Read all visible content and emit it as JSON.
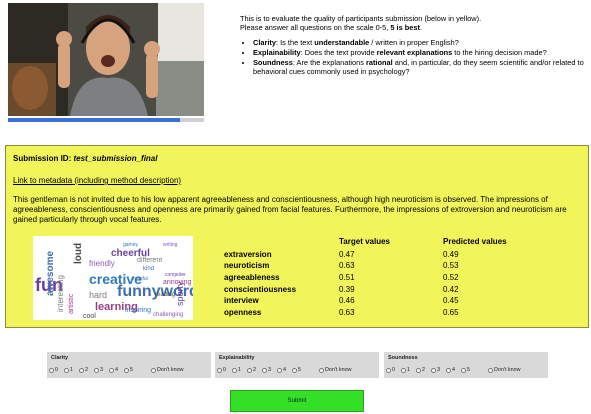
{
  "video": {
    "progress": 0.88
  },
  "instructions": {
    "intro_line1": "This is to evaluate the quality of participants submission (below in yellow).",
    "intro_line2_prefix": "Please answer all questions on the scale 0-5, ",
    "intro_line2_bold": "5 is best",
    "intro_line2_suffix": ".",
    "criteria": [
      {
        "name": "Clarity",
        "pre": ": Is the text ",
        "bold": "understandable",
        "post": " / written in proper English?"
      },
      {
        "name": "Explainability",
        "pre": ": Does the text provide ",
        "bold": "relevant explanations",
        "post": " to the hiring decision made?"
      },
      {
        "name": "Soundness",
        "pre": ": Are the explanations ",
        "bold": "rational",
        "post": " and, in particular, do they seem scientific and/or related to behavioral cues commonly used in psychology?"
      }
    ]
  },
  "submission": {
    "id_label": "Submission ID: ",
    "id_value": "test_submission_final",
    "metadata_link": "Link to metadata (including method description)",
    "explanation": "This gentleman is not invited due to his low apparent agreeableness and conscientiousness, although high neuroticism is observed. The impressions of agreeableness, conscientiousness and openness are primarily gained from facial features. Furthermore, the impressions of extroversion and neuroticism are gained particularly through vocal features.",
    "word_cloud": [
      "fun",
      "awesome",
      "interesting",
      "artistic",
      "loud",
      "creative",
      "friendly",
      "cheerful",
      "funnyword",
      "hard",
      "learning",
      "cool",
      "inspiring",
      "challenging",
      "sporty",
      "kind",
      "different",
      "annoying",
      "reading",
      "gamey",
      "writing",
      "computer",
      "helpful"
    ],
    "table": {
      "col_target": "Target values",
      "col_predicted": "Predicted values",
      "rows": [
        {
          "trait": "extraversion",
          "target": "0.47",
          "predicted": "0.49"
        },
        {
          "trait": "neuroticism",
          "target": "0.63",
          "predicted": "0.53"
        },
        {
          "trait": "agreeableness",
          "target": "0.51",
          "predicted": "0.52"
        },
        {
          "trait": "conscientiousness",
          "target": "0.39",
          "predicted": "0.42"
        },
        {
          "trait": "interview",
          "target": "0.46",
          "predicted": "0.45"
        },
        {
          "trait": "openness",
          "target": "0.63",
          "predicted": "0.65"
        }
      ]
    }
  },
  "ratings": {
    "options": [
      "0",
      "1",
      "2",
      "3",
      "4",
      "5"
    ],
    "dont_know": "Don't know",
    "panels": [
      {
        "title": "Clarity"
      },
      {
        "title": "Explainability"
      },
      {
        "title": "Soundness"
      }
    ]
  },
  "submit_label": "Submit"
}
